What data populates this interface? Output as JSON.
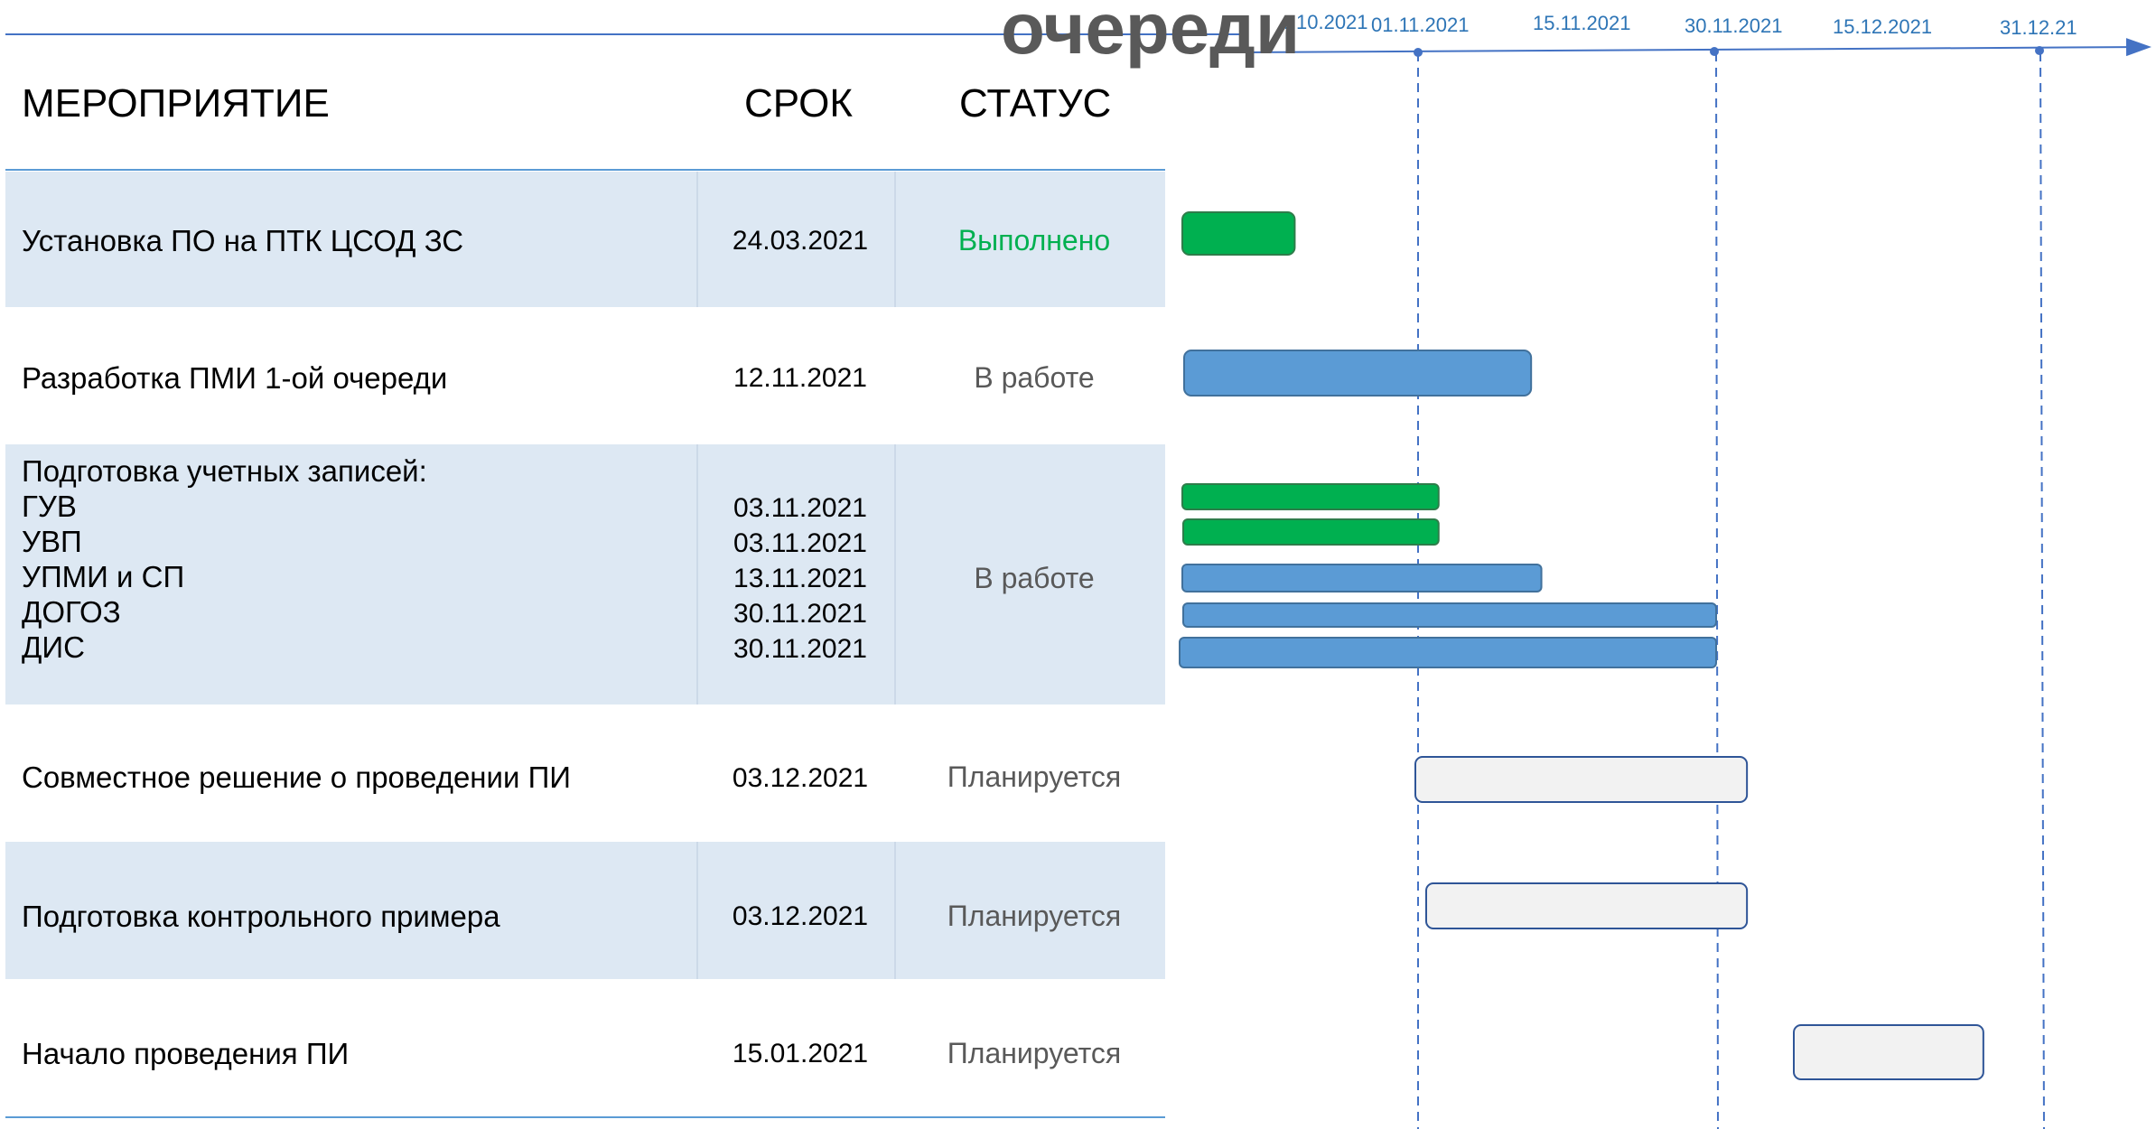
{
  "title_overlay": "очереди",
  "headers": {
    "event": "МЕРОПРИЯТИЕ",
    "term": "СРОК",
    "status": "СТАТУС"
  },
  "rows": [
    {
      "name": "Установка ПО на ПТК ЦСОД ЗС",
      "term": "24.03.2021",
      "status": "Выполнено"
    },
    {
      "name": "Разработка ПМИ 1-ой очереди",
      "term": "12.11.2021",
      "status": "В работе"
    },
    {
      "name_heading": "Подготовка учетных записей:",
      "sub_names": [
        "ГУВ",
        "УВП",
        "УПМИ и СП",
        "ДОГОЗ",
        "ДИС"
      ],
      "sub_terms": [
        "03.11.2021",
        "03.11.2021",
        "13.11.2021",
        "30.11.2021",
        "30.11.2021"
      ],
      "status": "В работе"
    },
    {
      "name": "Совместное решение о проведении ПИ",
      "term": "03.12.2021",
      "status": "Планируется"
    },
    {
      "name": "Подготовка контрольного примера",
      "term": "03.12.2021",
      "status": "Планируется"
    },
    {
      "name": "Начало проведения ПИ",
      "term": "15.01.2021",
      "status": "Планируется"
    }
  ],
  "colors": {
    "row_shade": "#dde8f3",
    "done": "#00b050",
    "in_progress": "#5b9bd5",
    "planned": "#f2f2f2",
    "axis": "#4472c4"
  },
  "chart_data": {
    "type": "gantt",
    "timeline_labels": [
      "…10.2021",
      "01.11.2021",
      "15.11.2021",
      "30.11.2021",
      "15.12.2021",
      "31.12.21"
    ],
    "reference_lines": [
      "01.11.2021",
      "30.11.2021",
      "31.12.21"
    ],
    "bars": [
      {
        "task": "Установка ПО на ПТК ЦСОД ЗС",
        "state": "done",
        "start": "2021-10-15",
        "end": "2021-10-20"
      },
      {
        "task": "Разработка ПМИ 1-ой очереди",
        "state": "in_progress",
        "start": "2021-10-15",
        "end": "2021-11-12"
      },
      {
        "task": "ГУВ",
        "state": "done",
        "start": "2021-10-15",
        "end": "2021-11-03"
      },
      {
        "task": "УВП",
        "state": "done",
        "start": "2021-10-15",
        "end": "2021-11-03"
      },
      {
        "task": "УПМИ и СП",
        "state": "in_progress",
        "start": "2021-10-15",
        "end": "2021-11-13"
      },
      {
        "task": "ДОГОЗ",
        "state": "in_progress",
        "start": "2021-10-15",
        "end": "2021-11-30"
      },
      {
        "task": "ДИС",
        "state": "in_progress",
        "start": "2021-10-15",
        "end": "2021-11-30"
      },
      {
        "task": "Совместное решение о проведении ПИ",
        "state": "planned",
        "start": "2021-11-01",
        "end": "2021-12-03"
      },
      {
        "task": "Подготовка контрольного примера",
        "state": "planned",
        "start": "2021-11-02",
        "end": "2021-12-03"
      },
      {
        "task": "Начало проведения ПИ",
        "state": "planned",
        "start": "2021-12-05",
        "end": "2021-12-26"
      }
    ]
  }
}
